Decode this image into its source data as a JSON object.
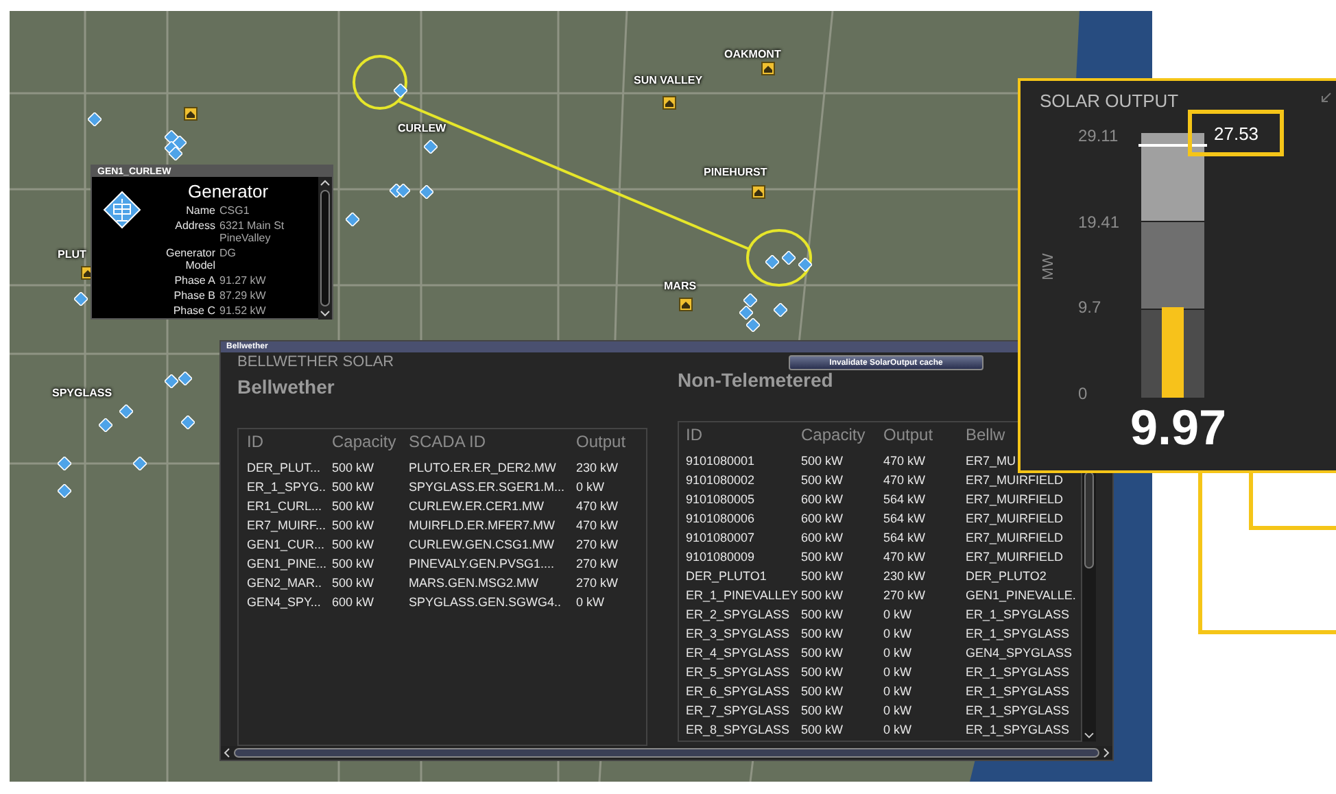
{
  "map": {
    "labels": [
      "OAKMONT",
      "SUN VALLEY",
      "CURLEW",
      "PINEHURST",
      "MARS",
      "PLUT",
      "SPYGLASS"
    ]
  },
  "generator_popup": {
    "title": "GEN1_CURLEW",
    "heading": "Generator",
    "fields": [
      {
        "label": "Name",
        "value": "CSG1"
      },
      {
        "label": "Address",
        "value": "6321 Main St PineValley"
      },
      {
        "label": "Generator Model",
        "value": "DG"
      },
      {
        "label": "Phase A",
        "value": "91.27 kW"
      },
      {
        "label": "Phase B",
        "value": "87.29 kW"
      },
      {
        "label": "Phase C",
        "value": "91.52 kW"
      }
    ]
  },
  "bellwether_window": {
    "title": "Bellwether",
    "heading": "BELLWETHER SOLAR",
    "button": "Invalidate SolarOutput cache",
    "bellwether": {
      "title": "Bellwether",
      "columns": [
        "ID",
        "Capacity",
        "SCADA ID",
        "Output"
      ],
      "rows": [
        [
          "DER_PLUT...",
          "500 kW",
          "PLUTO.ER.ER_DER2.MW",
          "230 kW"
        ],
        [
          "ER_1_SPYG..",
          "500 kW",
          "SPYGLASS.ER.SGER1.M...",
          "0 kW"
        ],
        [
          "ER1_CURL...",
          "500 kW",
          "CURLEW.ER.CER1.MW",
          "470 kW"
        ],
        [
          "ER7_MUIRF...",
          "500 kW",
          "MUIRFLD.ER.MFER7.MW",
          "470 kW"
        ],
        [
          "GEN1_CUR...",
          "500 kW",
          "CURLEW.GEN.CSG1.MW",
          "270 kW"
        ],
        [
          "GEN1_PINE...",
          "500 kW",
          "PINEVALY.GEN.PVSG1....",
          "270 kW"
        ],
        [
          "GEN2_MAR..",
          "500 kW",
          "MARS.GEN.MSG2.MW",
          "270 kW"
        ],
        [
          "GEN4_SPY...",
          "600 kW",
          "SPYGLASS.GEN.SGWG4..",
          "0 kW"
        ]
      ]
    },
    "non_telemetered": {
      "title": "Non-Telemetered",
      "columns": [
        "ID",
        "Capacity",
        "Output",
        "Bellw"
      ],
      "rows": [
        [
          "9101080001",
          "500 kW",
          "470 kW",
          "ER7_MU"
        ],
        [
          "9101080002",
          "500 kW",
          "470 kW",
          "ER7_MUIRFIELD"
        ],
        [
          "9101080005",
          "600 kW",
          "564 kW",
          "ER7_MUIRFIELD"
        ],
        [
          "9101080006",
          "600 kW",
          "564 kW",
          "ER7_MUIRFIELD"
        ],
        [
          "9101080007",
          "600 kW",
          "564 kW",
          "ER7_MUIRFIELD"
        ],
        [
          "9101080009",
          "500 kW",
          "470 kW",
          "ER7_MUIRFIELD"
        ],
        [
          "DER_PLUTO1",
          "500 kW",
          "230 kW",
          "DER_PLUTO2"
        ],
        [
          "ER_1_PINEVALLEY",
          "500 kW",
          "270 kW",
          "GEN1_PINEVALLE."
        ],
        [
          "ER_2_SPYGLASS",
          "500 kW",
          "0 kW",
          "ER_1_SPYGLASS"
        ],
        [
          "ER_3_SPYGLASS",
          "500 kW",
          "0 kW",
          "ER_1_SPYGLASS"
        ],
        [
          "ER_4_SPYGLASS",
          "500 kW",
          "0 kW",
          "GEN4_SPYGLASS"
        ],
        [
          "ER_5_SPYGLASS",
          "500 kW",
          "0 kW",
          "ER_1_SPYGLASS"
        ],
        [
          "ER_6_SPYGLASS",
          "500 kW",
          "0 kW",
          "ER_1_SPYGLASS"
        ],
        [
          "ER_7_SPYGLASS",
          "500 kW",
          "0 kW",
          "ER_1_SPYGLASS"
        ],
        [
          "ER_8_SPYGLASS",
          "500 kW",
          "0 kW",
          "ER_1_SPYGLASS"
        ]
      ]
    }
  },
  "solar_output": {
    "title": "SOLAR OUTPUT",
    "unit": "MW",
    "ticks": [
      "29.11",
      "19.41",
      "9.7",
      "0"
    ],
    "value": "9.97",
    "level": 0.3425,
    "marker": {
      "value": "27.53",
      "level": 0.946
    }
  }
}
